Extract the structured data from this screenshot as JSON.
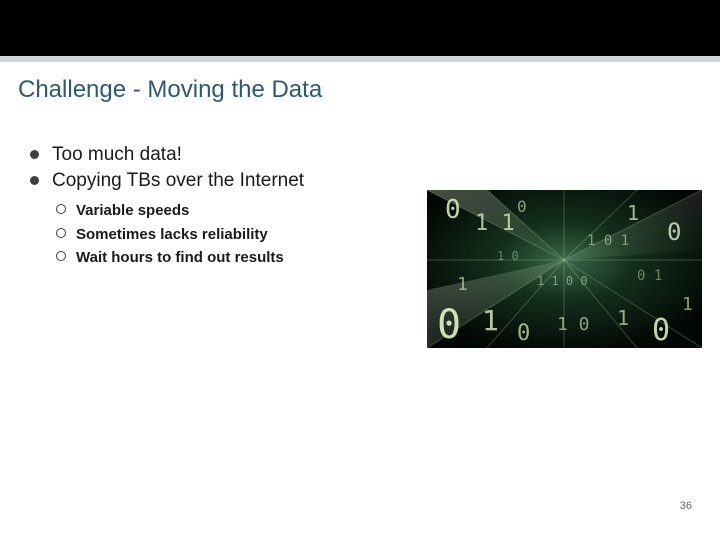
{
  "slide": {
    "title": "Challenge - Moving the Data",
    "bullets": [
      {
        "text": "Too much data!"
      },
      {
        "text": "Copying TBs over the Internet"
      }
    ],
    "subbullets": [
      {
        "text": "Variable speeds"
      },
      {
        "text": "Sometimes lacks reliability"
      },
      {
        "text": "Wait hours to find out results"
      }
    ],
    "page_number": "36",
    "image_alt": "digital-data-stream-illustration"
  }
}
